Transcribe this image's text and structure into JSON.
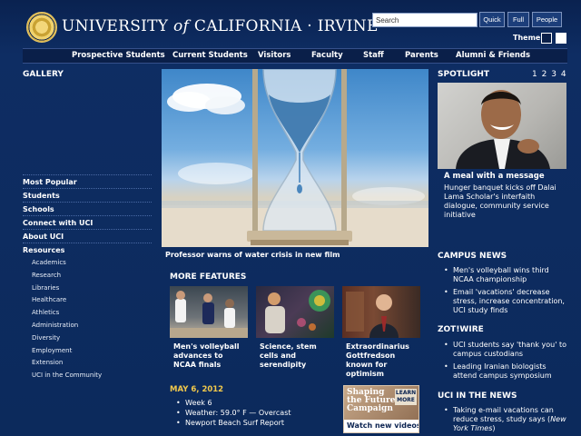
{
  "header": {
    "logo_text_1": "UNIVERSITY",
    "logo_text_of": "of",
    "logo_text_2": "CALIFORNIA · IRVINE",
    "search_placeholder": "Search",
    "buttons": [
      "Quick",
      "Full",
      "People"
    ],
    "theme_label": "Theme",
    "theme_colors": [
      "#0a1f49",
      "#ffffff"
    ]
  },
  "nav": [
    "Prospective Students",
    "Current Students",
    "Visitors",
    "Faculty",
    "Staff",
    "Parents",
    "Alumni & Friends"
  ],
  "gallery": {
    "title": "GALLERY",
    "menu": [
      "Most Popular",
      "Students",
      "Schools",
      "Connect with UCI",
      "About UCI"
    ],
    "resources_label": "Resources",
    "resources": [
      "Academics",
      "Research",
      "Libraries",
      "Healthcare",
      "Athletics",
      "Administration",
      "Diversity",
      "Employment",
      "Extension",
      "UCI in the Community"
    ]
  },
  "hero": {
    "caption": "Professor warns of water crisis in new film"
  },
  "features": {
    "title": "MORE FEATURES",
    "items": [
      {
        "caption": "Men's volleyball advances to NCAA finals"
      },
      {
        "caption": "Science, stem cells and serendipity"
      },
      {
        "caption": "Extraordinarius Gottfredson known for optimism"
      }
    ]
  },
  "today": {
    "date": "MAY 6, 2012",
    "items": [
      "Week 6",
      "Weather: 59.0° F — Overcast",
      "Newport Beach Surf Report"
    ]
  },
  "promo": {
    "line1": "Shaping",
    "line2": "the",
    "line3": "Future",
    "line4": "Campaign",
    "learn": "LEARN",
    "more": "MORE",
    "video": "Watch new videos ›"
  },
  "spotlight": {
    "title": "SPOTLIGHT",
    "pages": [
      "1",
      "2",
      "3",
      "4"
    ],
    "headline": "A meal with a message",
    "body": "Hunger banquet kicks off Dalai Lama Scholar's interfaith dialogue, community service initiative"
  },
  "campus_news": {
    "title": "CAMPUS NEWS",
    "items": [
      "Men's volleyball wins third NCAA championship",
      "Email 'vacations' decrease stress, increase concentration, UCI study finds"
    ]
  },
  "zotwire": {
    "title": "ZOT!WIRE",
    "items": [
      "UCI students say 'thank you' to campus custodians",
      "Leading Iranian biologists attend campus symposium"
    ]
  },
  "in_the_news": {
    "title": "UCI IN THE NEWS",
    "item_prefix": "Taking e-mail vacations can reduce stress, study says (",
    "item_source": "New York Times",
    "item_suffix": ")"
  }
}
